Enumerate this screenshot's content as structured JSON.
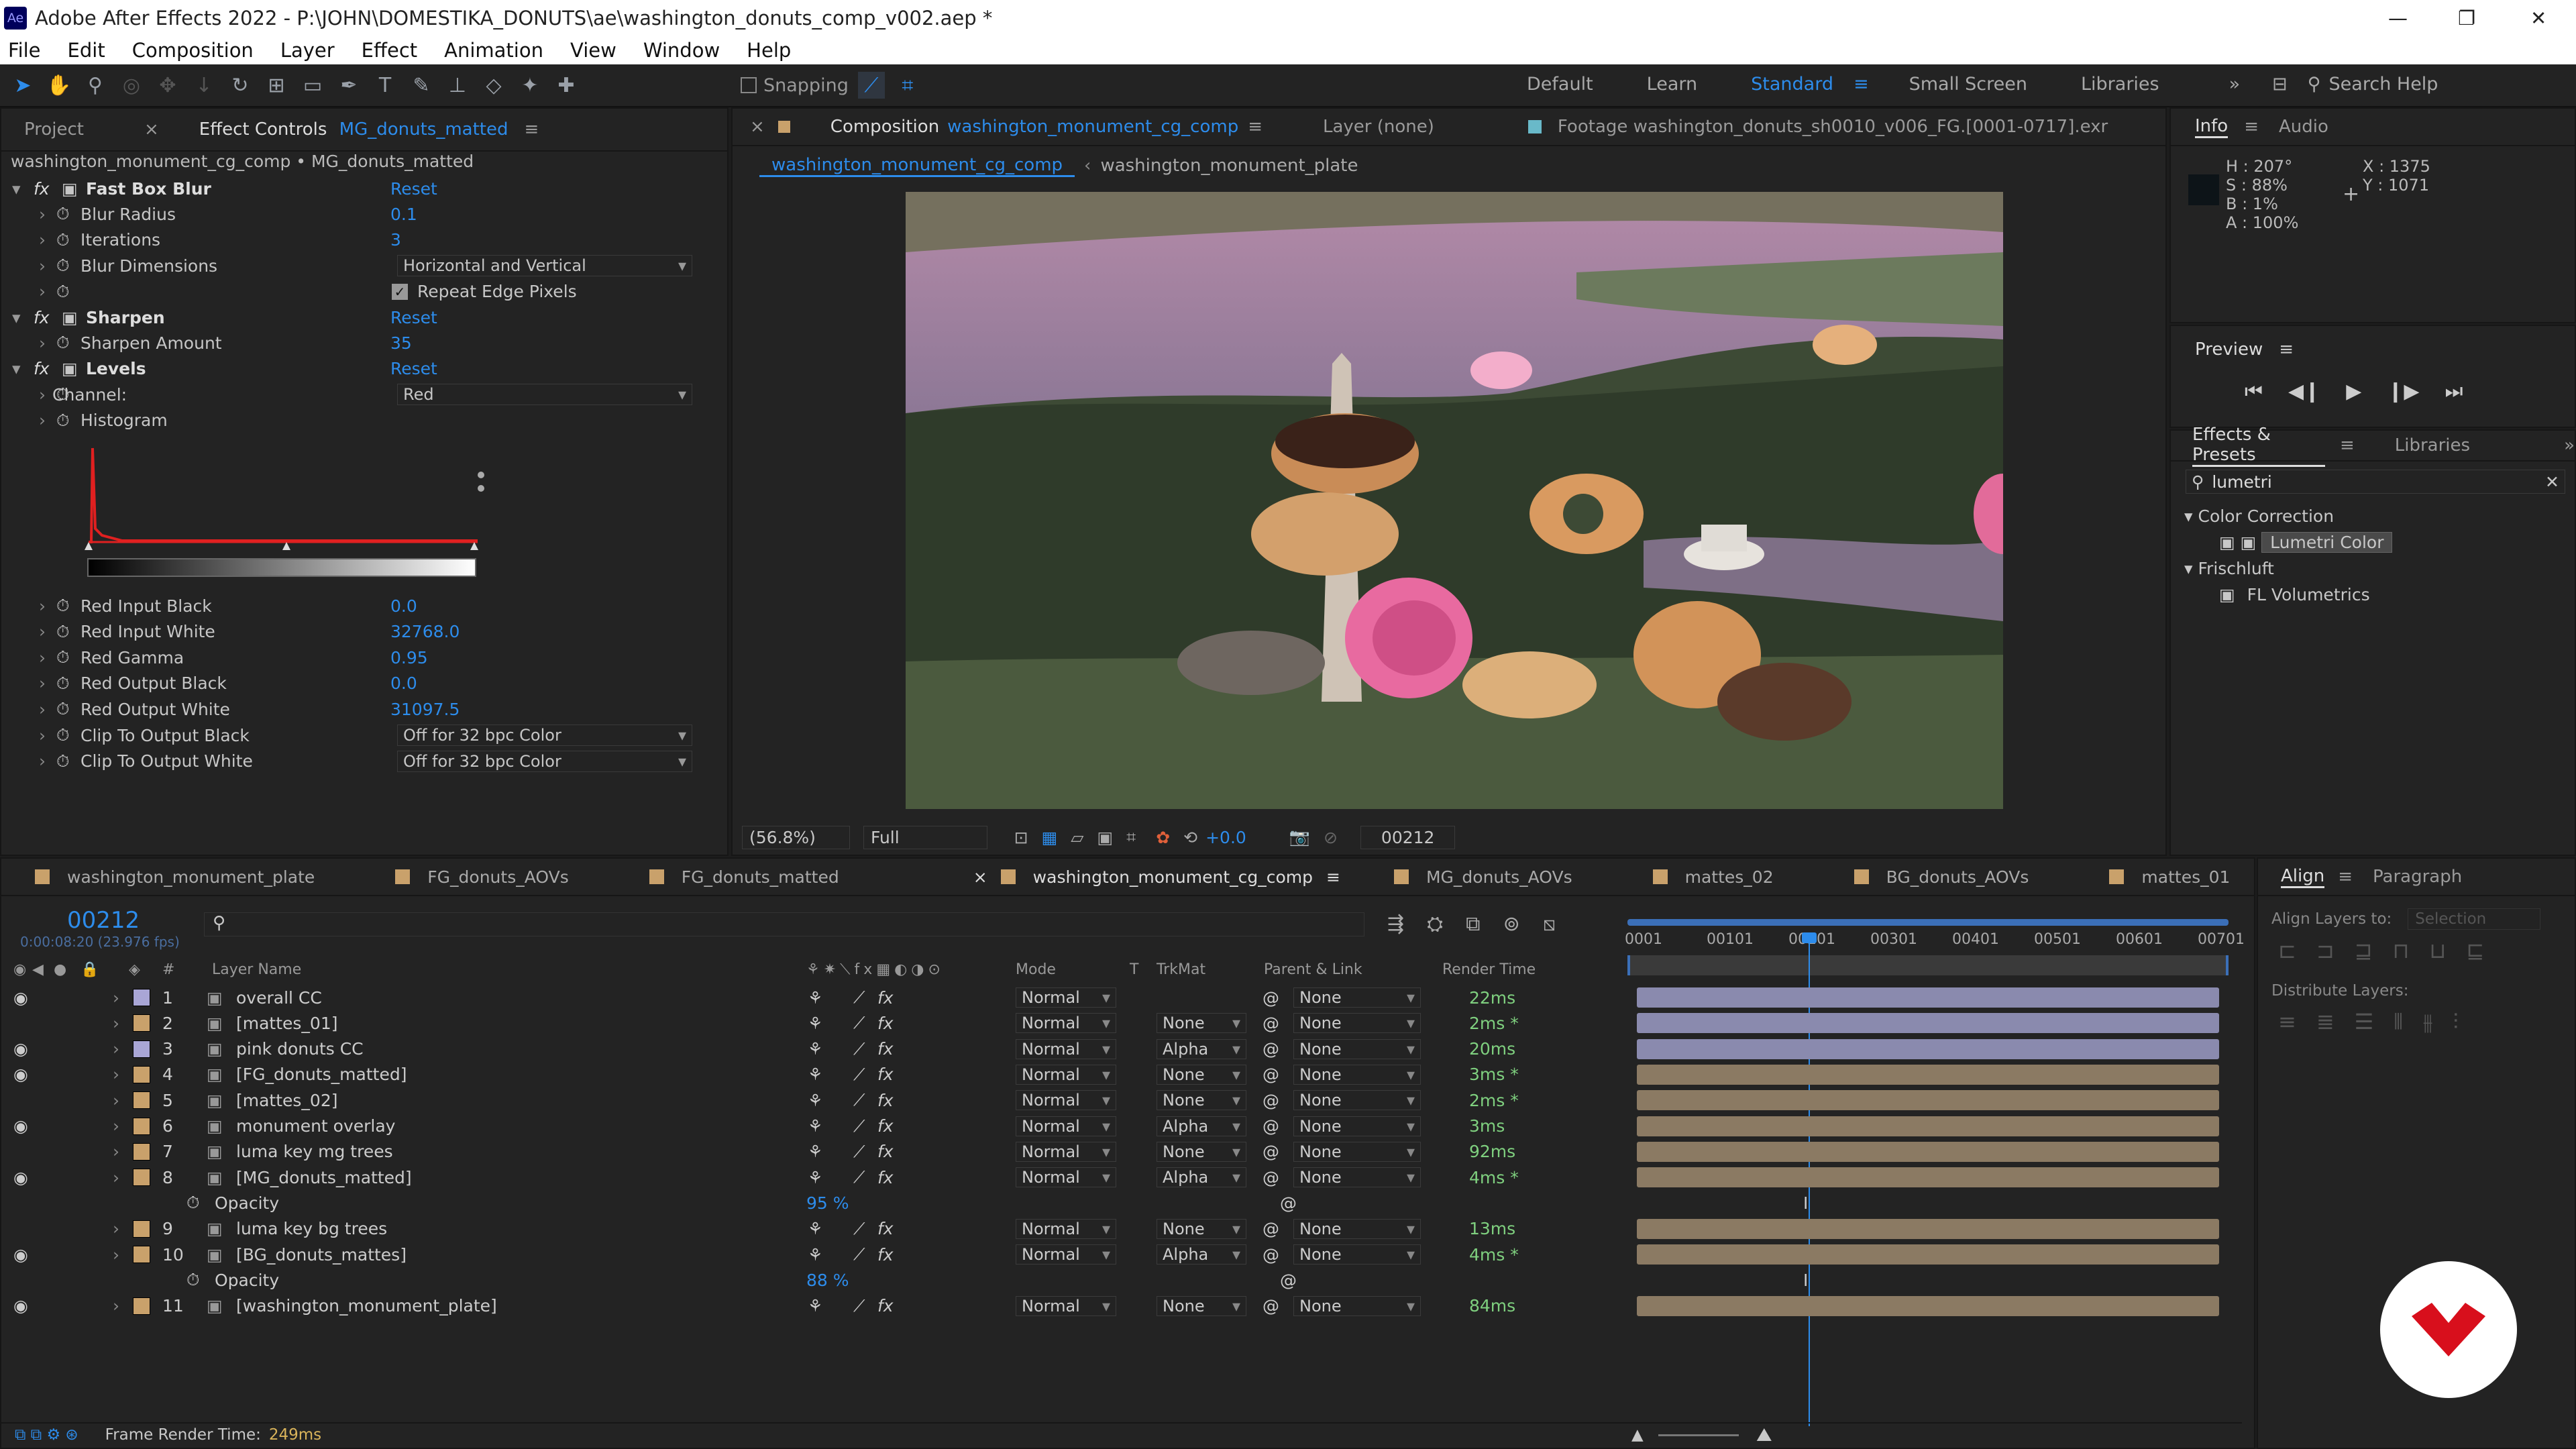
{
  "window": {
    "title": "Adobe After Effects 2022 - P:\\JOHN\\DOMESTIKA_DONUTS\\ae\\washington_donuts_comp_v002.aep *",
    "app_badge": "Ae",
    "min": "—",
    "max": "❐",
    "close": "✕"
  },
  "menu": [
    "File",
    "Edit",
    "Composition",
    "Layer",
    "Effect",
    "Animation",
    "View",
    "Window",
    "Help"
  ],
  "toolbar": {
    "snapping": "Snapping",
    "workspaces": [
      "Default",
      "Learn",
      "Standard",
      "Small Screen",
      "Libraries"
    ],
    "more": "»",
    "search": "Search Help"
  },
  "effect_controls": {
    "tab_project": "Project",
    "tab_ec": "Effect Controls",
    "tab_ec_layer": "MG_donuts_matted",
    "path": "washington_monument_cg_comp • MG_donuts_matted",
    "rows": [
      {
        "label": "Fast Box Blur",
        "value": "Reset",
        "fx": true
      },
      {
        "label": "Blur Radius",
        "value": "0.1"
      },
      {
        "label": "Iterations",
        "value": "3"
      },
      {
        "label": "Blur Dimensions",
        "drop": "Horizontal and Vertical"
      },
      {
        "label": "Repeat Edge Pixels",
        "check": true
      },
      {
        "label": "Sharpen",
        "value": "Reset",
        "fx": true
      },
      {
        "label": "Sharpen Amount",
        "value": "35"
      },
      {
        "label": "Levels",
        "value": "Reset",
        "fx": true
      },
      {
        "label": "Channel:",
        "drop": "Red"
      },
      {
        "label": "Histogram"
      }
    ],
    "rows2": [
      {
        "label": "Red Input Black",
        "value": "0.0"
      },
      {
        "label": "Red Input White",
        "value": "32768.0"
      },
      {
        "label": "Red Gamma",
        "value": "0.95"
      },
      {
        "label": "Red Output Black",
        "value": "0.0"
      },
      {
        "label": "Red Output White",
        "value": "31097.5"
      },
      {
        "label": "Clip To Output Black",
        "drop": "Off for 32 bpc Color"
      },
      {
        "label": "Clip To Output White",
        "drop": "Off for 32 bpc Color"
      }
    ]
  },
  "composition": {
    "tab_label": "Composition",
    "tab_name": "washington_monument_cg_comp",
    "layer_tab": "Layer (none)",
    "footage_tab": "Footage washington_donuts_sh0010_v006_FG.[0001-0717].exr",
    "sub_tabs": [
      "washington_monument_cg_comp",
      "washington_monument_plate"
    ],
    "zoom": "(56.8%)",
    "resolution": "Full",
    "exposure": "+0.0",
    "frame": "00212"
  },
  "info": {
    "tab": "Info",
    "tab2": "Audio",
    "h": "H : 207°",
    "s": "S : 88%",
    "b": "B : 1%",
    "a": "A : 100%",
    "x": "X : 1375",
    "y": "Y : 1071"
  },
  "preview": {
    "title": "Preview"
  },
  "effects_presets": {
    "tab": "Effects & Presets",
    "tab2": "Libraries",
    "search": "lumetri",
    "cat1": "Color Correction",
    "item1": "Lumetri Color",
    "cat2": "Frischluft",
    "item2": "FL Volumetrics"
  },
  "timeline": {
    "tabs": [
      "washington_monument_plate",
      "FG_donuts_AOVs",
      "FG_donuts_matted",
      "washington_monument_cg_comp",
      "MG_donuts_AOVs",
      "mattes_02",
      "BG_donuts_AOVs",
      "mattes_01"
    ],
    "timecode": "00212",
    "timecode_sub": "0:00:08:20 (23.976 fps)",
    "headers": {
      "num": "#",
      "name": "Layer Name",
      "mode": "Mode",
      "t": "T",
      "trkmat": "TrkMat",
      "parent": "Parent & Link",
      "render": "Render Time"
    },
    "ruler": [
      "0001",
      "00101",
      "00201",
      "00301",
      "00401",
      "00501",
      "00601",
      "00701"
    ],
    "layers": [
      {
        "n": "1",
        "name": "overall CC",
        "mode": "Normal",
        "trk": "",
        "parent": "None",
        "rt": "22ms",
        "eye": true,
        "color": "#a9a6d6"
      },
      {
        "n": "2",
        "name": "[mattes_01]",
        "mode": "Normal",
        "trk": "None",
        "parent": "None",
        "rt": "2ms *",
        "eye": false,
        "color": "#c9a16b"
      },
      {
        "n": "3",
        "name": "pink donuts CC",
        "mode": "Normal",
        "trk": "Alpha",
        "parent": "None",
        "rt": "20ms",
        "eye": true,
        "color": "#a9a6d6"
      },
      {
        "n": "4",
        "name": "[FG_donuts_matted]",
        "mode": "Normal",
        "trk": "None",
        "parent": "None",
        "rt": "3ms *",
        "eye": true,
        "color": "#c9a16b"
      },
      {
        "n": "5",
        "name": "[mattes_02]",
        "mode": "Normal",
        "trk": "None",
        "parent": "None",
        "rt": "2ms *",
        "eye": false,
        "color": "#c9a16b"
      },
      {
        "n": "6",
        "name": "monument overlay",
        "mode": "Normal",
        "trk": "Alpha",
        "parent": "None",
        "rt": "3ms",
        "eye": true,
        "color": "#c9a16b"
      },
      {
        "n": "7",
        "name": "luma key mg trees",
        "mode": "Normal",
        "trk": "None",
        "parent": "None",
        "rt": "92ms",
        "eye": false,
        "color": "#c9a16b"
      },
      {
        "n": "8",
        "name": "[MG_donuts_matted]",
        "mode": "Normal",
        "trk": "Alpha",
        "parent": "None",
        "rt": "4ms *",
        "eye": true,
        "color": "#c9a16b"
      },
      {
        "n": "",
        "name": "Opacity",
        "opacity": "95 %"
      },
      {
        "n": "9",
        "name": "luma key bg trees",
        "mode": "Normal",
        "trk": "None",
        "parent": "None",
        "rt": "13ms",
        "eye": false,
        "color": "#c9a16b"
      },
      {
        "n": "10",
        "name": "[BG_donuts_mattes]",
        "mode": "Normal",
        "trk": "Alpha",
        "parent": "None",
        "rt": "4ms *",
        "eye": true,
        "color": "#c9a16b"
      },
      {
        "n": "",
        "name": "Opacity",
        "opacity": "88 %"
      },
      {
        "n": "11",
        "name": "[washington_monument_plate]",
        "mode": "Normal",
        "trk": "None",
        "parent": "None",
        "rt": "84ms",
        "eye": true,
        "color": "#c9a16b"
      }
    ],
    "frame_render": "Frame Render Time:",
    "frame_render_val": "249ms"
  },
  "align": {
    "tab": "Align",
    "tab2": "Paragraph",
    "align_to": "Align Layers to:",
    "align_sel": "Selection",
    "distribute": "Distribute Layers:"
  }
}
